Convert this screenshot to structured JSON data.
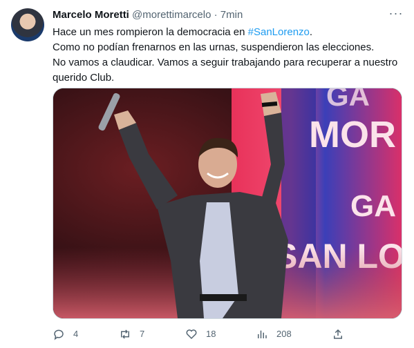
{
  "tweet": {
    "author_name": "Marcelo Moretti",
    "handle": "@morettimarcelo",
    "separator": "·",
    "time": "7min",
    "more_icon": "more-icon",
    "text_lines": [
      {
        "before": "Hace un mes rompieron la democracia en ",
        "hashtag": "#SanLorenzo",
        "after": "."
      },
      {
        "before": "Como no podían frenarnos en las urnas, suspendieron las elecciones.",
        "hashtag": "",
        "after": ""
      },
      {
        "before": "No vamos a claudicar. Vamos a seguir trabajando para recuperar a nuestro",
        "hashtag": "",
        "after": ""
      },
      {
        "before": "querido Club.",
        "hashtag": "",
        "after": ""
      }
    ],
    "media": {
      "banner_words": [
        "GA",
        "MOR",
        "GA",
        "SAN LO"
      ]
    },
    "actions": {
      "replies": "4",
      "retweets": "7",
      "likes": "18",
      "views": "208"
    },
    "colors": {
      "link": "#1d9bf0",
      "muted": "#536471",
      "text": "#0f1419"
    }
  }
}
